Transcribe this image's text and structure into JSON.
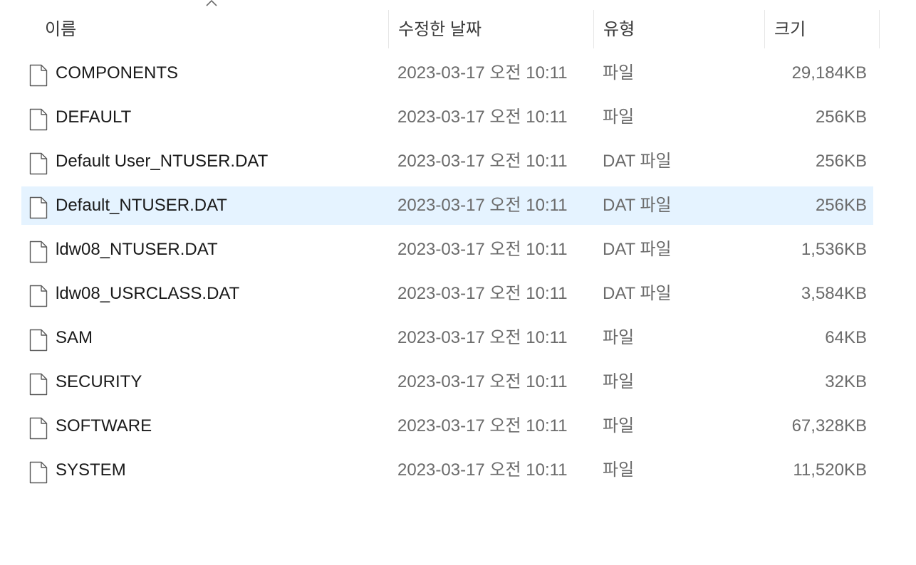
{
  "columns": {
    "name": "이름",
    "date": "수정한 날짜",
    "type": "유형",
    "size": "크기"
  },
  "sort": {
    "column": "name",
    "direction": "ascending",
    "icon": "chevron-up-icon"
  },
  "files": [
    {
      "name": "COMPONENTS",
      "date": "2023-03-17 오전 10:11",
      "type": "파일",
      "size": "29,184KB",
      "icon": "file-icon",
      "selected": false
    },
    {
      "name": "DEFAULT",
      "date": "2023-03-17 오전 10:11",
      "type": "파일",
      "size": "256KB",
      "icon": "file-icon",
      "selected": false
    },
    {
      "name": "Default User_NTUSER.DAT",
      "date": "2023-03-17 오전 10:11",
      "type": "DAT 파일",
      "size": "256KB",
      "icon": "file-icon",
      "selected": false
    },
    {
      "name": "Default_NTUSER.DAT",
      "date": "2023-03-17 오전 10:11",
      "type": "DAT 파일",
      "size": "256KB",
      "icon": "file-icon",
      "selected": true
    },
    {
      "name": "ldw08_NTUSER.DAT",
      "date": "2023-03-17 오전 10:11",
      "type": "DAT 파일",
      "size": "1,536KB",
      "icon": "file-icon",
      "selected": false
    },
    {
      "name": "ldw08_USRCLASS.DAT",
      "date": "2023-03-17 오전 10:11",
      "type": "DAT 파일",
      "size": "3,584KB",
      "icon": "file-icon",
      "selected": false
    },
    {
      "name": "SAM",
      "date": "2023-03-17 오전 10:11",
      "type": "파일",
      "size": "64KB",
      "icon": "file-icon",
      "selected": false
    },
    {
      "name": "SECURITY",
      "date": "2023-03-17 오전 10:11",
      "type": "파일",
      "size": "32KB",
      "icon": "file-icon",
      "selected": false
    },
    {
      "name": "SOFTWARE",
      "date": "2023-03-17 오전 10:11",
      "type": "파일",
      "size": "67,328KB",
      "icon": "file-icon",
      "selected": false
    },
    {
      "name": "SYSTEM",
      "date": "2023-03-17 오전 10:11",
      "type": "파일",
      "size": "11,520KB",
      "icon": "file-icon",
      "selected": false
    }
  ],
  "colors": {
    "selection": "#e5f3ff",
    "secondary_text": "#6b6b6b",
    "primary_text": "#1a1a1a"
  }
}
